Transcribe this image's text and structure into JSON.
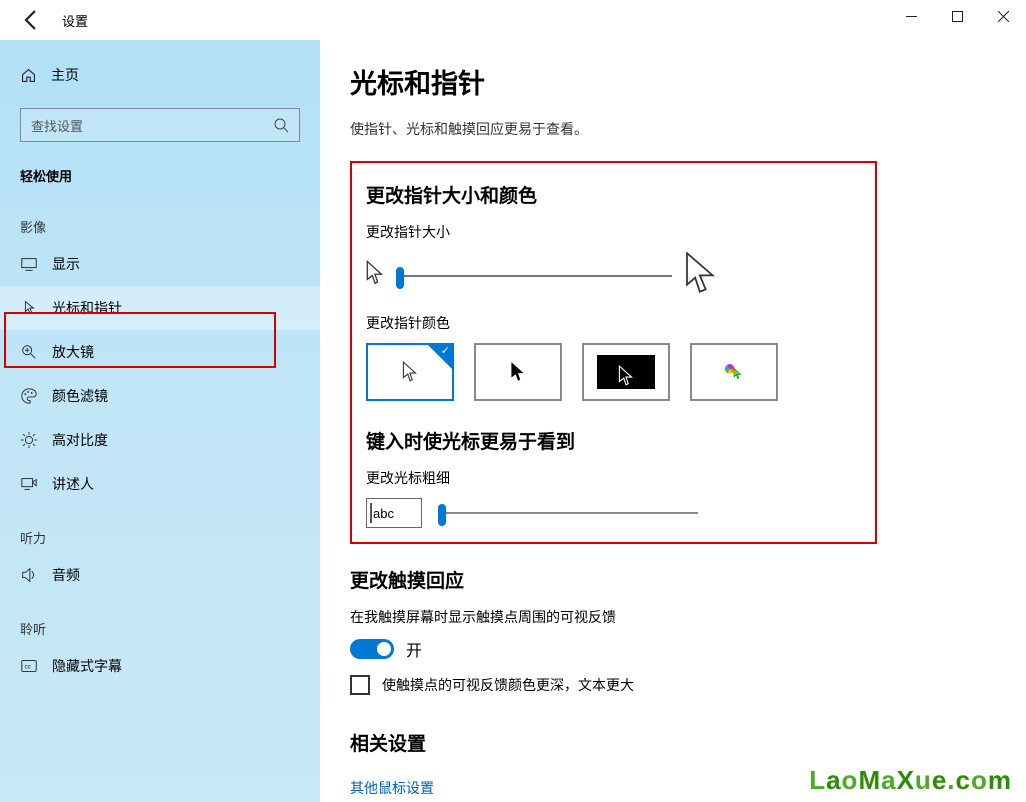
{
  "window": {
    "title": "设置"
  },
  "sidebar": {
    "home": "主页",
    "search_placeholder": "查找设置",
    "category": "轻松使用",
    "groups": {
      "visual": "影像",
      "hearing": "听力",
      "interaction": "聆听"
    },
    "items": {
      "display": "显示",
      "cursor": "光标和指针",
      "magnifier": "放大镜",
      "colorfilter": "颜色滤镜",
      "contrast": "高对比度",
      "narrator": "讲述人",
      "audio": "音频",
      "captions": "隐藏式字幕"
    }
  },
  "page": {
    "title": "光标和指针",
    "subtitle": "使指针、光标和触摸回应更易于查看。",
    "sec_size_color": "更改指针大小和颜色",
    "lbl_size": "更改指针大小",
    "lbl_color": "更改指针颜色",
    "sec_typing": "键入时使光标更易于看到",
    "lbl_thickness": "更改光标粗细",
    "abc": "abc",
    "sec_touch": "更改触摸回应",
    "lbl_touch_feedback": "在我触摸屏幕时显示触摸点周围的可视反馈",
    "toggle_on": "开",
    "lbl_darker": "使触摸点的可视反馈颜色更深，文本更大",
    "sec_related": "相关设置",
    "link_mouse": "其他鼠标设置"
  },
  "watermark": {
    "text": "LaoMaXue.com"
  }
}
